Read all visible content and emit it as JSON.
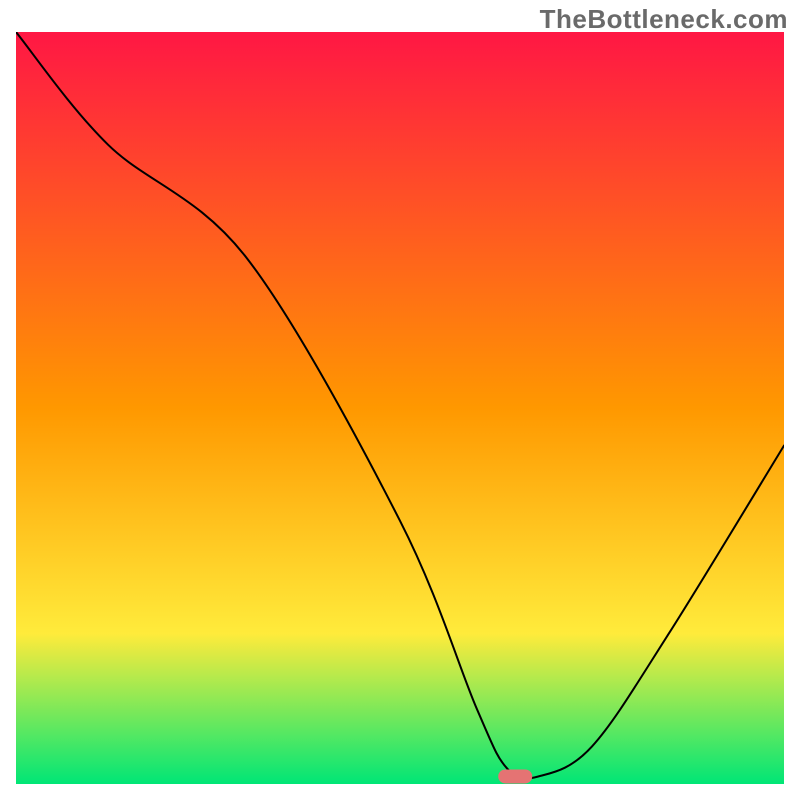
{
  "watermark": "TheBottleneck.com",
  "chart_data": {
    "type": "line",
    "title": "",
    "xlabel": "",
    "ylabel": "",
    "xlim": [
      0,
      100
    ],
    "ylim": [
      0,
      100
    ],
    "grid": false,
    "legend": false,
    "gradient_colors": {
      "top": "#ff1744",
      "mid_upper": "#ff9800",
      "mid_lower": "#ffeb3b",
      "bottom": "#00e676"
    },
    "series": [
      {
        "name": "bottleneck-curve",
        "x": [
          0,
          12,
          30,
          50,
          60,
          64,
          68,
          75,
          85,
          100
        ],
        "y": [
          100,
          85,
          70,
          35,
          10,
          2,
          1,
          5,
          20,
          45
        ]
      }
    ],
    "marker": {
      "x": 65,
      "y": 1,
      "color": "#e57373"
    }
  }
}
